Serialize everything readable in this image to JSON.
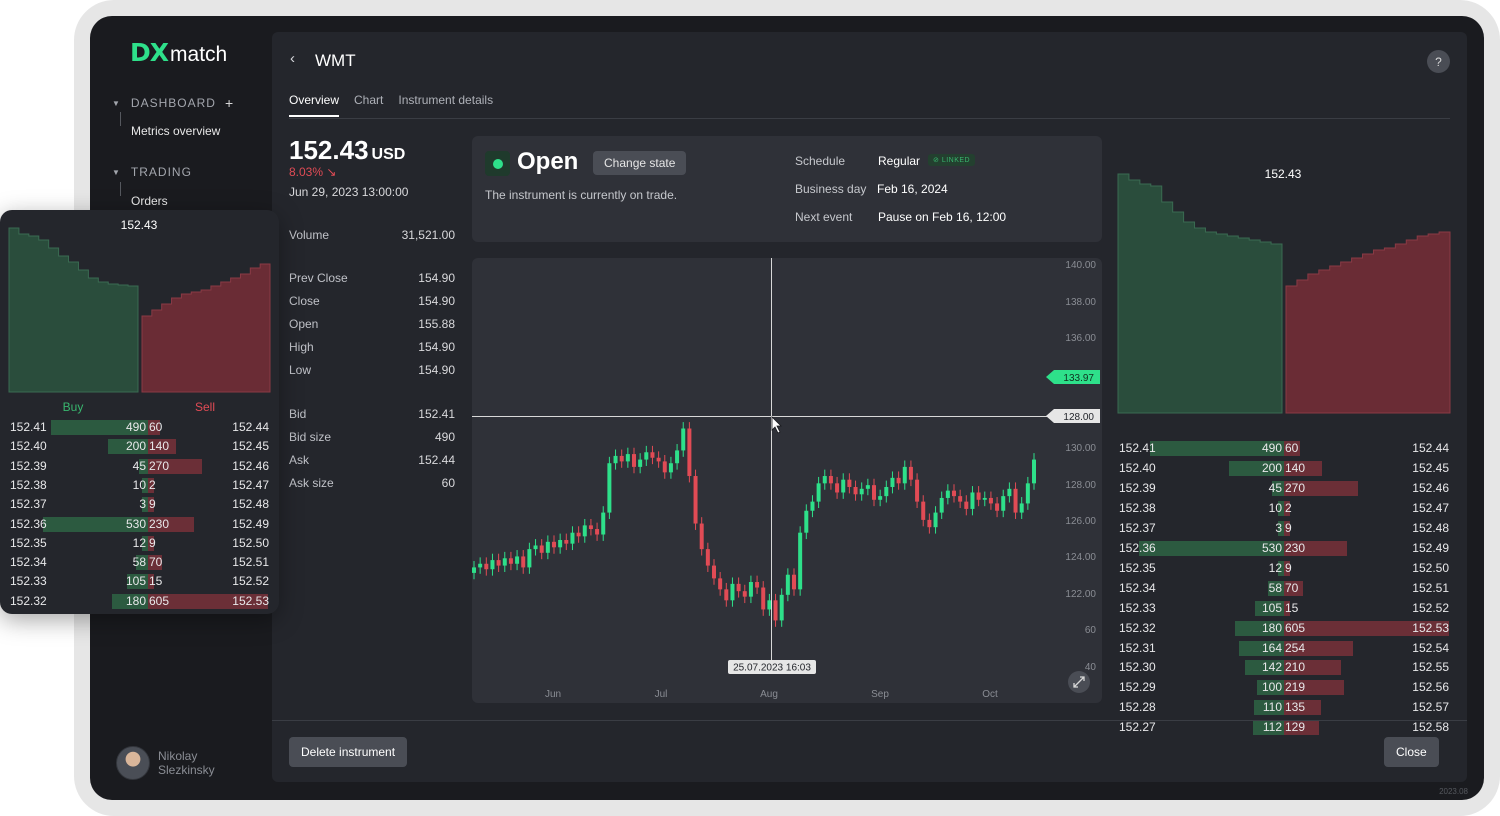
{
  "app": {
    "logo_dx": "DX",
    "logo_match": "match",
    "version": "2023.08"
  },
  "sidebar": {
    "sections": [
      {
        "label": "DASHBOARD",
        "items": [
          "Metrics overview"
        ]
      },
      {
        "label": "TRADING",
        "items": [
          "Orders"
        ]
      }
    ],
    "user": {
      "first": "Nikolay",
      "last": "Slezkinsky"
    }
  },
  "header": {
    "back_icon": "chevron-left-icon",
    "title": "WMT",
    "help": "?"
  },
  "tabs": [
    "Overview",
    "Chart",
    "Instrument details"
  ],
  "quote": {
    "price": "152.43",
    "currency": "USD",
    "change": "8.03%",
    "datetime": "Jun 29, 2023 13:00:00"
  },
  "stats": [
    {
      "label": "Volume",
      "value": "31,521.00"
    },
    {
      "label": "Prev Close",
      "value": "154.90"
    },
    {
      "label": "Close",
      "value": "154.90"
    },
    {
      "label": "Open",
      "value": "155.88"
    },
    {
      "label": "High",
      "value": "154.90"
    },
    {
      "label": "Low",
      "value": "154.90"
    },
    {
      "label": "Bid",
      "value": "152.41"
    },
    {
      "label": "Bid size",
      "value": "490"
    },
    {
      "label": "Ask",
      "value": "152.44"
    },
    {
      "label": "Ask size",
      "value": "60"
    }
  ],
  "state": {
    "label": "Open",
    "change_button": "Change state",
    "description": "The instrument is currently on trade.",
    "schedule_label": "Schedule",
    "schedule_value": "Regular",
    "linked": "LINKED",
    "business_day_label": "Business day",
    "business_day_value": "Feb 16, 2024",
    "next_event_label": "Next event",
    "next_event_value": "Pause on Feb 16, 12:00"
  },
  "chart": {
    "y_ticks": [
      "140.00",
      "138.00",
      "136.00",
      "130.00",
      "128.00",
      "126.00",
      "124.00",
      "122.00",
      "60",
      "40"
    ],
    "x_ticks": [
      "Jun",
      "Jul",
      "Aug",
      "Sep",
      "Oct"
    ],
    "last_price_label": "133.97",
    "cursor_price_label": "128.00",
    "cursor_time_label": "25.07.2023 16:03",
    "colors": {
      "up": "#2ee08a",
      "down": "#e14b55"
    }
  },
  "depth": {
    "mid_price": "152.43",
    "buy_label": "Buy",
    "sell_label": "Sell",
    "colors": {
      "buy": "#2c5a40",
      "sell": "#6b2f37"
    },
    "rows": [
      {
        "bid": "152.41",
        "bid_size": "490",
        "ask_size": "60",
        "ask": "152.44"
      },
      {
        "bid": "152.40",
        "bid_size": "200",
        "ask_size": "140",
        "ask": "152.45"
      },
      {
        "bid": "152.39",
        "bid_size": "45",
        "ask_size": "270",
        "ask": "152.46"
      },
      {
        "bid": "152.38",
        "bid_size": "10",
        "ask_size": "2",
        "ask": "152.47"
      },
      {
        "bid": "152.37",
        "bid_size": "3",
        "ask_size": "9",
        "ask": "152.48"
      },
      {
        "bid": "152.36",
        "bid_size": "530",
        "ask_size": "230",
        "ask": "152.49"
      },
      {
        "bid": "152.35",
        "bid_size": "12",
        "ask_size": "9",
        "ask": "152.50"
      },
      {
        "bid": "152.34",
        "bid_size": "58",
        "ask_size": "70",
        "ask": "152.51"
      },
      {
        "bid": "152.33",
        "bid_size": "105",
        "ask_size": "15",
        "ask": "152.52"
      },
      {
        "bid": "152.32",
        "bid_size": "180",
        "ask_size": "605",
        "ask": "152.53"
      },
      {
        "bid": "152.31",
        "bid_size": "164",
        "ask_size": "254",
        "ask": "152.54"
      },
      {
        "bid": "152.30",
        "bid_size": "142",
        "ask_size": "210",
        "ask": "152.55"
      },
      {
        "bid": "152.29",
        "bid_size": "100",
        "ask_size": "219",
        "ask": "152.56"
      },
      {
        "bid": "152.28",
        "bid_size": "110",
        "ask_size": "135",
        "ask": "152.57"
      },
      {
        "bid": "152.27",
        "bid_size": "112",
        "ask_size": "129",
        "ask": "152.58"
      }
    ]
  },
  "footer": {
    "delete": "Delete instrument",
    "close": "Close"
  }
}
